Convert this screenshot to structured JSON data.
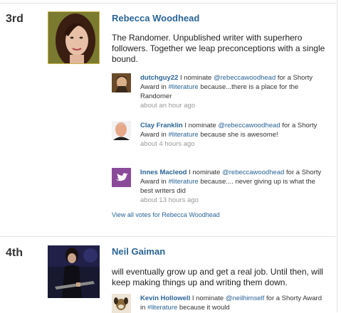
{
  "entries": [
    {
      "rank": "3rd",
      "name": "Rebecca Woodhead",
      "bio": "The Randomer. Unpublished writer with superhero followers. Together we leap preconceptions with a single bound.",
      "votes": [
        {
          "user": "dutchguy22",
          "text_before": " I nominate ",
          "handle": "@rebeccawoodhead",
          "text_mid": " for a Shorty Award in ",
          "tag": "#literature",
          "text_after": " because...there is a place for the Randomer",
          "time": "about an hour ago",
          "avatar": "portrait-photo"
        },
        {
          "user": "Clay Franklin",
          "text_before": " I nominate ",
          "handle": "@rebeccawoodhead",
          "text_mid": " for a Shorty Award in ",
          "tag": "#literature",
          "text_after": " because she is awesome!",
          "time": "about 4 hours ago",
          "avatar": "man-photo"
        },
        {
          "user": "Innes Macleod",
          "text_before": " I nominate ",
          "handle": "@rebeccawoodhead",
          "text_mid": " for a Shorty Award in ",
          "tag": "#literature",
          "text_after": " because.... never giving up is what the best writers did",
          "time": "about 13 hours ago",
          "avatar": "twitter-bird-icon"
        }
      ],
      "view_all": "View all votes for Rebecca Woodhead"
    },
    {
      "rank": "4th",
      "name": "Neil Gaiman",
      "bio": "will eventually grow up and get a real job. Until then, will keep making things up and writing them down.",
      "votes": [
        {
          "user": "Kevin Hollowell",
          "text_before": " I nominate ",
          "handle": "@neilhimself",
          "text_mid": " for a Shorty Award in ",
          "tag": "#literature",
          "text_after": " because it would",
          "time": "",
          "avatar": "dog-photo"
        }
      ]
    }
  ]
}
